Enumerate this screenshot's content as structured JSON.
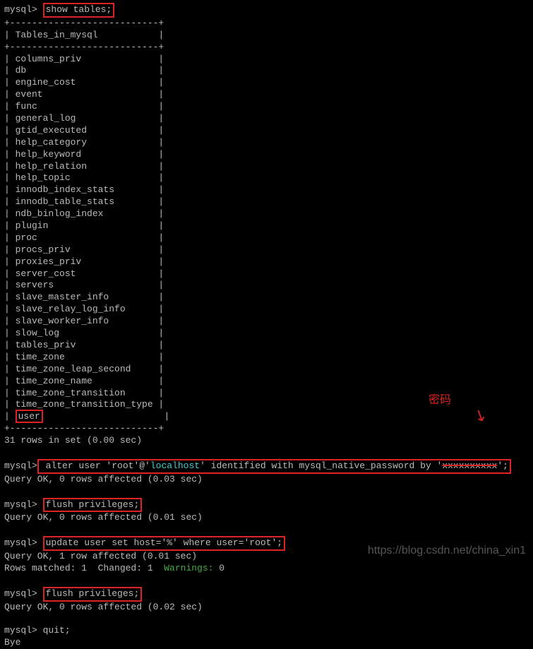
{
  "prompt": "mysql>",
  "cmd_show_tables": "show tables;",
  "table_header": "Tables_in_mysql",
  "tables": [
    "columns_priv",
    "db",
    "engine_cost",
    "event",
    "func",
    "general_log",
    "gtid_executed",
    "help_category",
    "help_keyword",
    "help_relation",
    "help_topic",
    "innodb_index_stats",
    "innodb_table_stats",
    "ndb_binlog_index",
    "plugin",
    "proc",
    "procs_priv",
    "proxies_priv",
    "server_cost",
    "servers",
    "slave_master_info",
    "slave_relay_log_info",
    "slave_worker_info",
    "slow_log",
    "tables_priv",
    "time_zone",
    "time_zone_leap_second",
    "time_zone_name",
    "time_zone_transition",
    "time_zone_transition_type"
  ],
  "user_table": "user",
  "rows_in_set": "31 rows in set (0.00 sec)",
  "alter_user": {
    "pre": " alter user 'root'@'",
    "host": "localhost",
    "mid": "' identified with mysql_native_password by '",
    "redacted": "xxxxxxxxxx",
    "post": "';"
  },
  "alter_result": "Query OK, 0 rows affected (0.03 sec)",
  "flush_priv": "flush privileges;",
  "flush_result1": "Query OK, 0 rows affected (0.01 sec)",
  "update_user": "update user set host='%' where user='root';",
  "update_result1": "Query OK, 1 row affected (0.01 sec)",
  "update_result2_pre": "Rows matched: 1  Changed: 1  ",
  "update_result2_warn": "Warnings:",
  "update_result2_zero": " 0",
  "flush_result2": "Query OK, 0 rows affected (0.02 sec)",
  "quit": " quit;",
  "bye": "Bye",
  "annotation_password": "密码",
  "watermark": "https://blog.csdn.net/china_xin1",
  "border_line": "+---------------------------+"
}
